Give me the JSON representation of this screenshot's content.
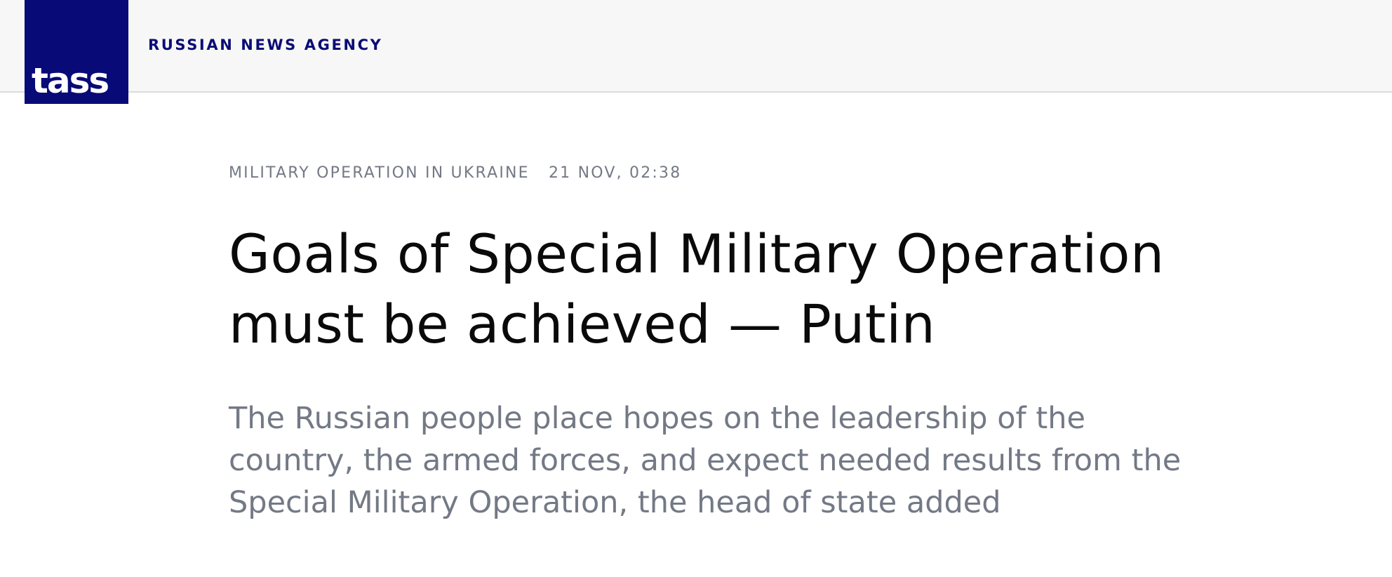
{
  "header": {
    "logo_text": "TASS",
    "agency_name": "RUSSIAN NEWS AGENCY"
  },
  "article": {
    "category": "MILITARY OPERATION IN UKRAINE",
    "date": "21 NOV, 02:38",
    "title": "Goals of Special Military Operation must be achieved — Putin",
    "lead": "The Russian people place hopes on the leadership of the country, the armed forces, and expect needed results from the Special Military Operation, the head of state added"
  },
  "colors": {
    "brand": "#080a78",
    "header_bg": "#f7f7f7",
    "meta_text": "#737985",
    "title_text": "#0a0a0a"
  }
}
